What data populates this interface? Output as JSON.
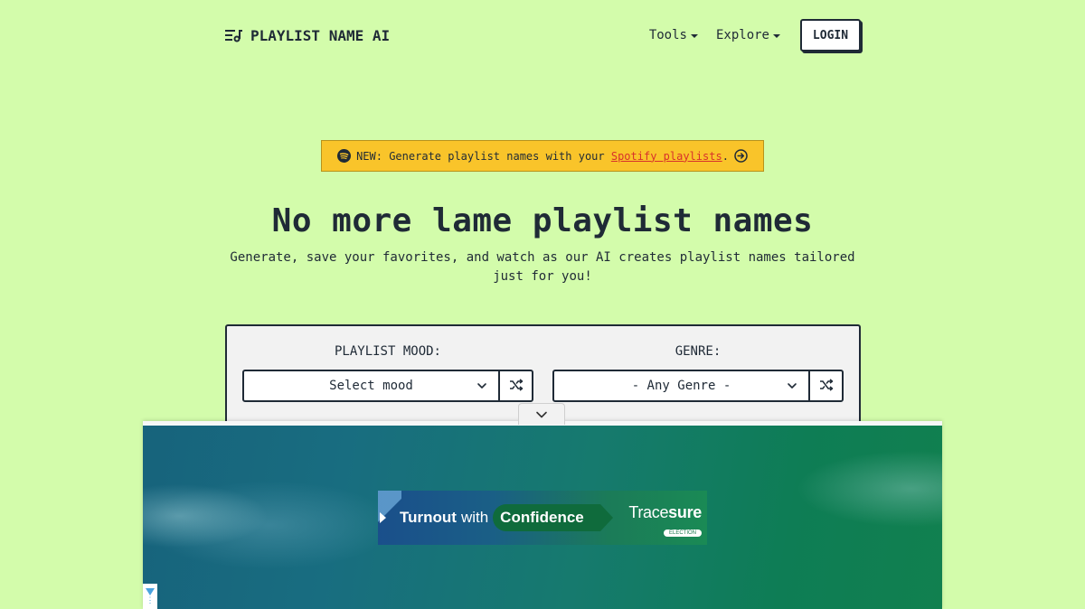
{
  "header": {
    "brand": "PLAYLIST NAME AI",
    "nav": [
      {
        "label": "Tools"
      },
      {
        "label": "Explore"
      }
    ],
    "login_label": "LOGIN"
  },
  "banner": {
    "prefix": "NEW: Generate playlist names with your",
    "link_text": "Spotify playlists",
    "suffix": ".",
    "accent_color": "#f9c42a",
    "link_color": "#d8322b"
  },
  "hero": {
    "title": "No more lame playlist names",
    "subtitle": "Generate, save your favorites, and watch as our AI creates playlist names tailored just for you!"
  },
  "form": {
    "mood_label": "PLAYLIST MOOD:",
    "mood_value": "Select mood",
    "genre_label": "GENRE:",
    "genre_value": "- Any Genre -"
  },
  "ad": {
    "headline_pre": "Turnout",
    "headline_mid": "with",
    "headline_pill": "Confidence",
    "brand_light": "Trace",
    "brand_bold": "sure",
    "brand_tag": "ELECTION"
  },
  "colors": {
    "page_background": "#d3fcab",
    "text": "#1f2a36",
    "card_background": "#f2f2f2"
  }
}
